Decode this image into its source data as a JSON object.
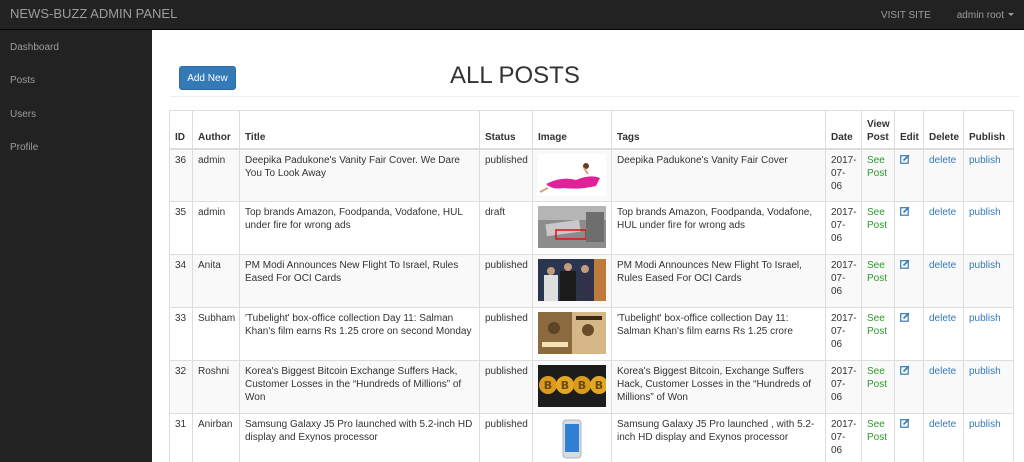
{
  "header": {
    "brand": "NEWS-BUZZ ADMIN PANEL",
    "visit_site": "VISIT SITE",
    "user_menu": "admin root"
  },
  "sidebar": {
    "items": [
      {
        "label": "Dashboard"
      },
      {
        "label": "Posts"
      },
      {
        "label": "Users"
      },
      {
        "label": "Profile"
      }
    ]
  },
  "main": {
    "add_new_label": "Add New",
    "page_title": "ALL POSTS"
  },
  "table": {
    "columns": [
      "ID",
      "Author",
      "Title",
      "Status",
      "Image",
      "Tags",
      "Date",
      "View Post",
      "Edit",
      "Delete",
      "Publish"
    ],
    "rows": [
      {
        "id": "36",
        "author": "admin",
        "title": "Deepika Padukone's Vanity Fair Cover. We Dare You To Look Away",
        "status": "published",
        "image": "woman-pink-dress-thumbnail",
        "tags": "Deepika Padukone's Vanity Fair Cover",
        "date": "2017-07-06",
        "view": "See Post",
        "delete": "delete",
        "publish": "publish"
      },
      {
        "id": "35",
        "author": "admin",
        "title": "Top brands Amazon, Foodpanda, Vodafone, HUL under fire for wrong ads",
        "status": "draft",
        "image": "fake-stamp-thumbnail",
        "tags": "Top brands Amazon, Foodpanda, Vodafone, HUL under fire for wrong ads",
        "date": "2017-07-06",
        "view": "See Post",
        "delete": "delete",
        "publish": "publish"
      },
      {
        "id": "34",
        "author": "Anita",
        "title": "PM Modi Announces New Flight To Israel, Rules Eased For OCI Cards",
        "status": "published",
        "image": "leaders-meeting-thumbnail",
        "tags": "PM Modi Announces New Flight To Israel, Rules Eased For OCI Cards",
        "date": "2017-07-06",
        "view": "See Post",
        "delete": "delete",
        "publish": "publish"
      },
      {
        "id": "33",
        "author": "Subham",
        "title": "'Tubelight' box-office collection Day 11: Salman Khan's film earns Rs 1.25 crore on second Monday",
        "status": "published",
        "image": "movie-poster-thumbnail",
        "tags": "'Tubelight' box-office collection Day 11: Salman Khan's film earns Rs 1.25 crore",
        "date": "2017-07-06",
        "view": "See Post",
        "delete": "delete",
        "publish": "publish"
      },
      {
        "id": "32",
        "author": "Roshni",
        "title": "Korea's Biggest Bitcoin Exchange Suffers Hack, Customer Losses in the “Hundreds of Millions” of Won",
        "status": "published",
        "image": "bitcoin-coins-thumbnail",
        "tags": "Korea's Biggest Bitcoin, Exchange Suffers Hack, Customer Losses in the “Hundreds of Millions” of Won",
        "date": "2017-07-06",
        "view": "See Post",
        "delete": "delete",
        "publish": "publish"
      },
      {
        "id": "31",
        "author": "Anirban",
        "title": "Samsung Galaxy J5 Pro launched with 5.2-inch HD display and Exynos processor",
        "status": "published",
        "image": "phone-thumbnail",
        "tags": "Samsung Galaxy J5 Pro launched , with 5.2-inch HD display and Exynos processor",
        "date": "2017-07-06",
        "view": "See Post",
        "delete": "delete",
        "publish": "publish"
      }
    ]
  },
  "colors": {
    "navbar": "#222222",
    "primary": "#337ab7",
    "link_green": "#2a9a2a"
  }
}
